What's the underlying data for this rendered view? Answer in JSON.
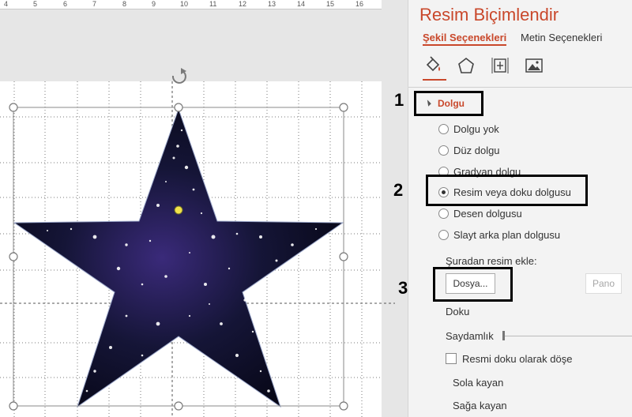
{
  "ruler": {
    "numbers": [
      "4",
      "5",
      "6",
      "7",
      "8",
      "9",
      "10",
      "11",
      "12",
      "13",
      "14",
      "15",
      "16"
    ]
  },
  "pane": {
    "title": "Resim Biçimlendir",
    "tabs": [
      {
        "label": "Şekil Seçenekleri",
        "active": true
      },
      {
        "label": "Metin Seçenekleri",
        "active": false
      }
    ],
    "icons": [
      "fill-line-icon",
      "effects-pentagon-icon",
      "size-properties-icon",
      "picture-icon"
    ],
    "section_title": "Dolgu",
    "fill_options": [
      {
        "label": "Dolgu yok",
        "checked": false
      },
      {
        "label": "Düz dolgu",
        "checked": false
      },
      {
        "label": "Gradyan dolgu",
        "checked": false
      },
      {
        "label": "Resim veya doku dolgusu",
        "checked": true
      },
      {
        "label": "Desen dolgusu",
        "checked": false
      },
      {
        "label": "Slayt arka plan dolgusu",
        "checked": false
      }
    ],
    "insert_from_label": "Şuradan resim ekle:",
    "file_button": "Dosya...",
    "clipboard_button": "Pano",
    "texture_label": "Doku",
    "transparency_label": "Saydamlık",
    "tile_checkbox_label": "Resmi doku olarak döşe",
    "offset_left_label": "Sola kayan",
    "offset_right_label": "Sağa kayan"
  },
  "steps": [
    "1",
    "2",
    "3"
  ],
  "colors": {
    "accent": "#c9482b",
    "pane_bg": "#f3f3f3",
    "star_fill": "#0d0d24"
  }
}
